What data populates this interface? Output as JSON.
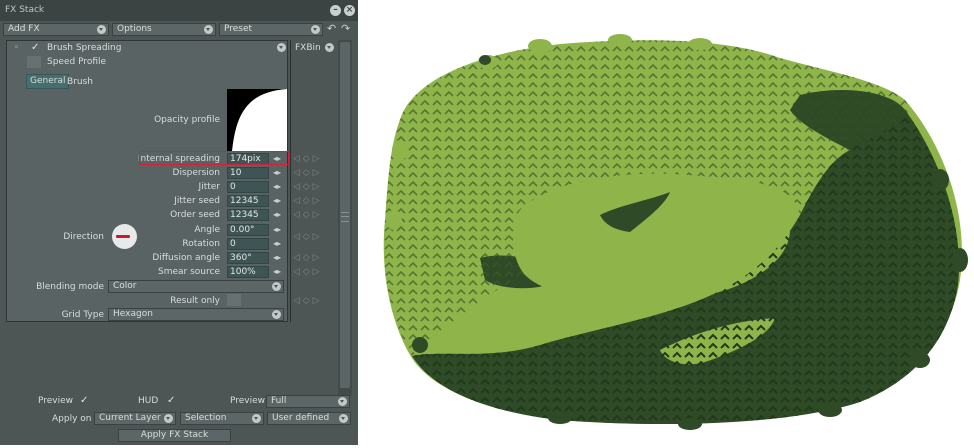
{
  "window": {
    "title": "FX Stack"
  },
  "toolbar": {
    "add_fx": "Add FX",
    "options": "Options",
    "preset": "Preset"
  },
  "fx": {
    "name": "Brush Spreading",
    "speed_profile": "Speed Profile",
    "tabs": [
      "General",
      "Brush"
    ],
    "opacity_profile_label": "Opacity profile",
    "fxbin": "FXBin"
  },
  "params": [
    {
      "label": "Internal spreading",
      "value": "174pix"
    },
    {
      "label": "Dispersion",
      "value": "10"
    },
    {
      "label": "Jitter",
      "value": "0"
    },
    {
      "label": "Jitter seed",
      "value": "12345"
    },
    {
      "label": "Order seed",
      "value": "12345"
    },
    {
      "label": "Angle",
      "value": "0.00°"
    },
    {
      "label": "Rotation",
      "value": "0"
    },
    {
      "label": "Diffusion angle",
      "value": "360°"
    },
    {
      "label": "Smear source",
      "value": "100%"
    }
  ],
  "direction_label": "Direction",
  "blending": {
    "label": "Blending mode",
    "value": "Color"
  },
  "result_only": "Result only",
  "grid": {
    "label": "Grid Type",
    "value": "Hexagon"
  },
  "bottom": {
    "preview_label": "Preview",
    "hud_label": "HUD",
    "preview2_label": "Preview",
    "preview2_value": "Full",
    "apply_on_label": "Apply on",
    "apply_on_value": "Current Layer",
    "selection": "Selection",
    "user_defined": "User defined",
    "apply_button": "Apply FX Stack"
  },
  "colors": {
    "light_green": "#8fb54a",
    "mid_green": "#5a7f34",
    "dark_green": "#2f4a26",
    "highlight": "#d4203a"
  }
}
